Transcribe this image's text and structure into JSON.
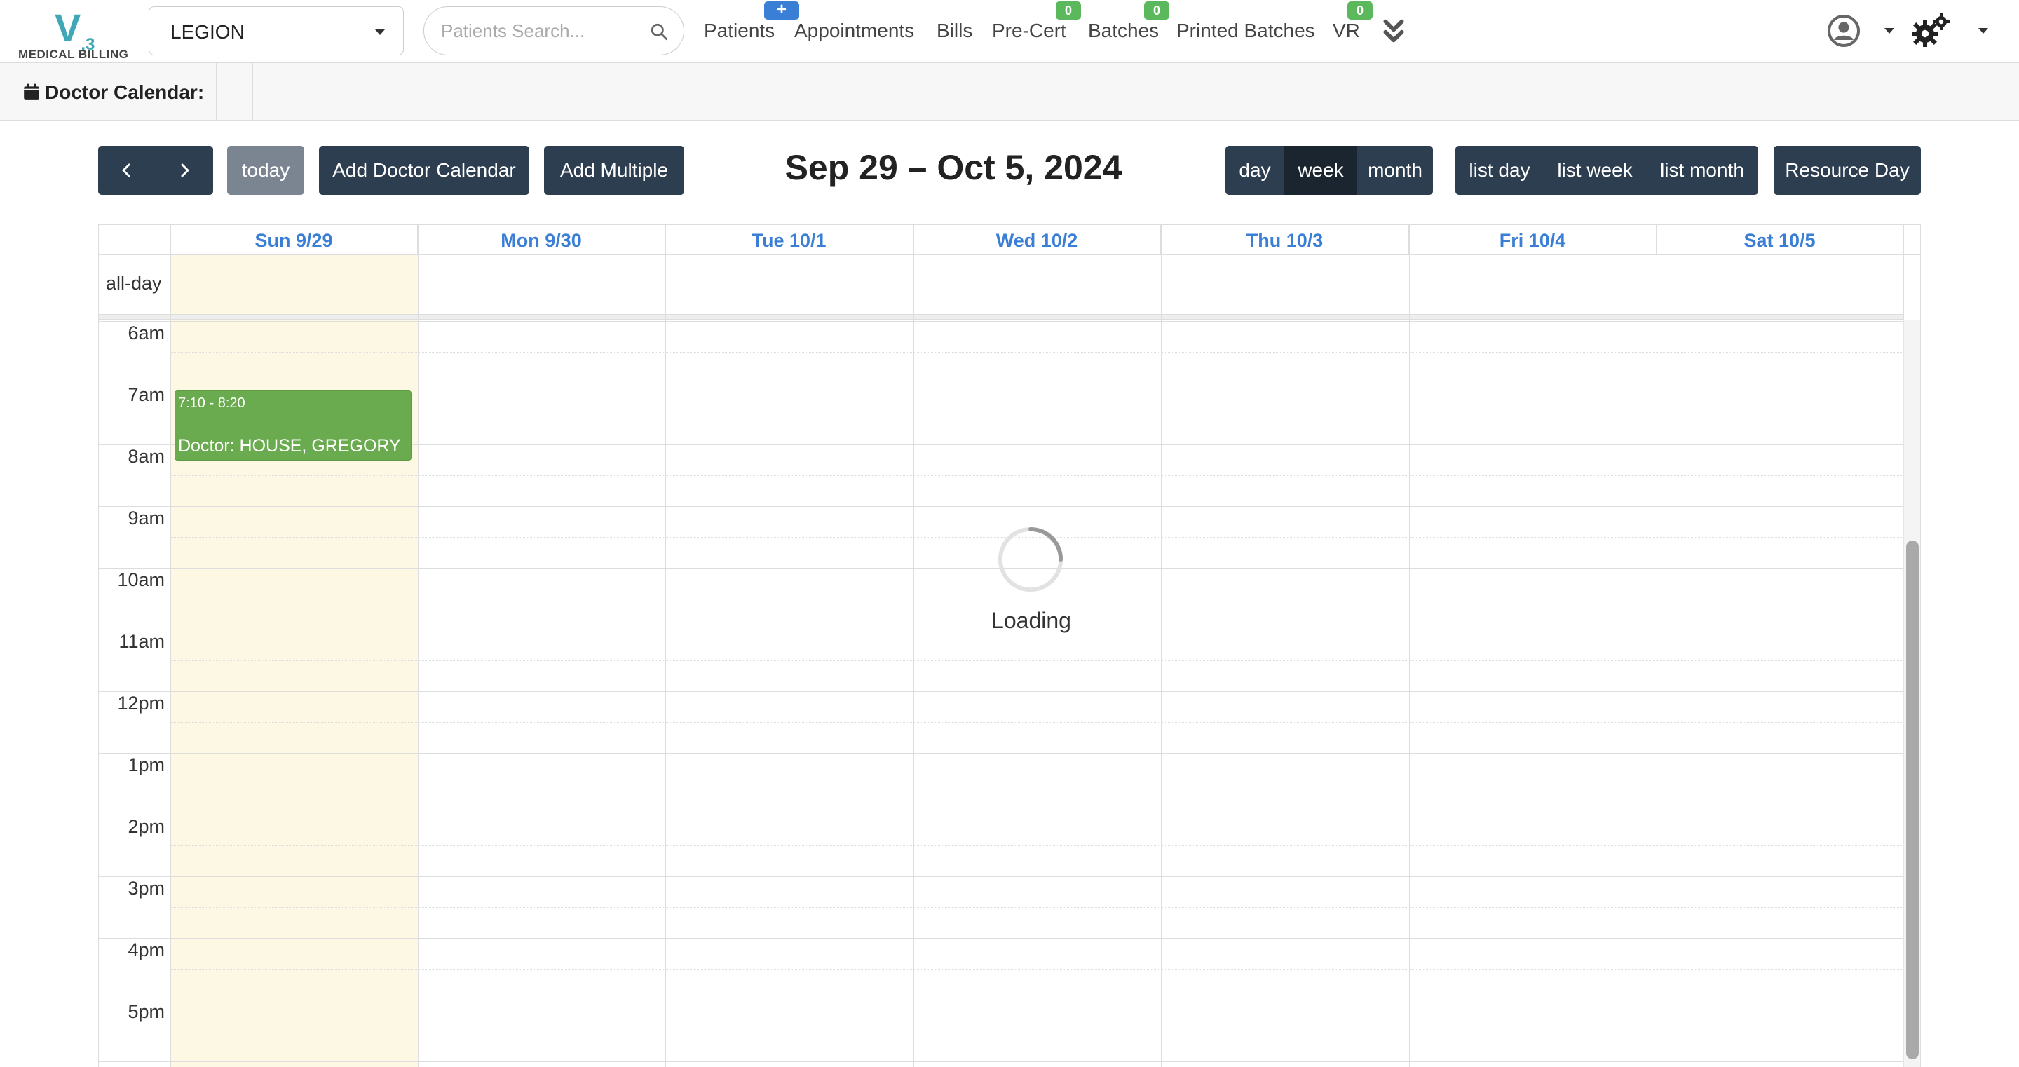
{
  "logo": {
    "mark": "V",
    "version": ".3",
    "name": "MEDICAL BILLING"
  },
  "practice_select": {
    "value": "LEGION"
  },
  "search": {
    "placeholder": "Patients Search..."
  },
  "nav": {
    "items": [
      {
        "label": "Patients",
        "badge": "+"
      },
      {
        "label": "Appointments"
      },
      {
        "label": "Bills"
      },
      {
        "label": "Pre-Cert",
        "badge": "0"
      },
      {
        "label": "Batches",
        "badge": "0"
      },
      {
        "label": "Printed Batches"
      },
      {
        "label": "VR",
        "badge": "0"
      }
    ],
    "more_icon": "chevron-double-down-icon",
    "user_icon": "user-circle-icon",
    "settings_icon": "gears-icon"
  },
  "subheader": {
    "title": "Doctor Calendar:",
    "icon": "calendar-icon"
  },
  "toolbar": {
    "prev_icon": "chevron-left-icon",
    "next_icon": "chevron-right-icon",
    "today": "today",
    "add_doctor_calendar": "Add Doctor Calendar",
    "add_multiple": "Add Multiple",
    "title": "Sep 29 – Oct 5, 2024",
    "views": [
      "day",
      "week",
      "month"
    ],
    "active_view": "week",
    "list_views": [
      "list day",
      "list week",
      "list month"
    ],
    "resource_day": "Resource Day"
  },
  "calendar": {
    "days": [
      "Sun 9/29",
      "Mon 9/30",
      "Tue 10/1",
      "Wed 10/2",
      "Thu 10/3",
      "Fri 10/4",
      "Sat 10/5"
    ],
    "today_index": 0,
    "allday_label": "all-day",
    "hours": [
      "6am",
      "7am",
      "8am",
      "9am",
      "10am",
      "11am",
      "12pm",
      "1pm",
      "2pm",
      "3pm",
      "4pm",
      "5pm"
    ],
    "events": [
      {
        "time": "7:10 - 8:20",
        "label": "Doctor: HOUSE, GREGORY",
        "day": "Sun 9/29",
        "color": "#6aab4f"
      }
    ],
    "loading_text": "Loading"
  },
  "colors": {
    "primary": "#2c3e50",
    "link": "#3a7fd5",
    "today_bg": "#fcf8e3",
    "badge_green": "#5cb85c",
    "badge_blue": "#3a7fd5"
  }
}
